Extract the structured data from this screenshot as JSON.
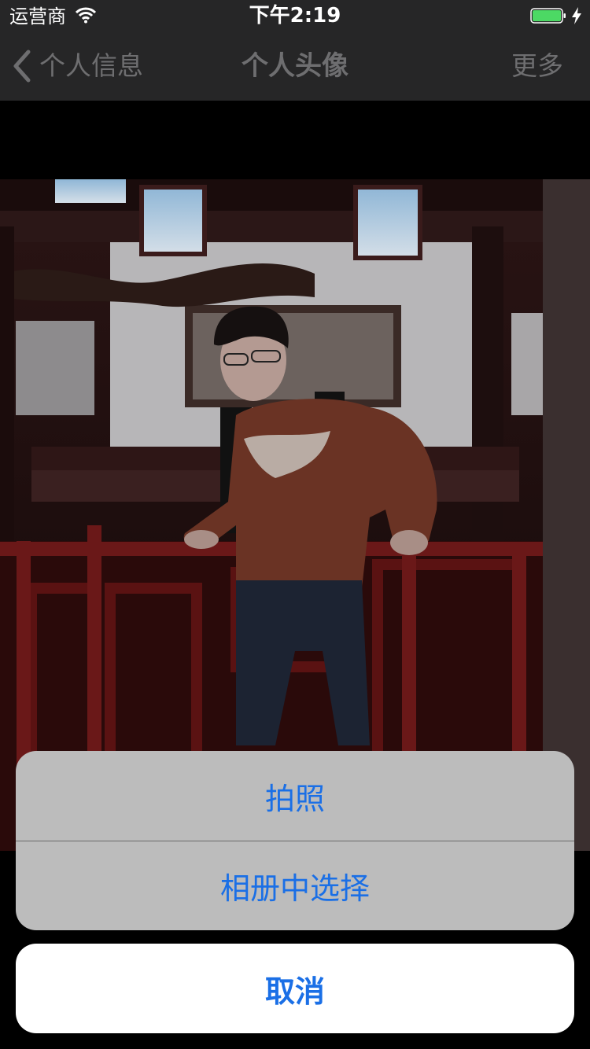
{
  "status_bar": {
    "carrier": "运营商",
    "time": "下午2:19",
    "battery_color": "#4cd964",
    "icons": [
      "wifi-icon",
      "battery-icon",
      "charging-bolt-icon"
    ]
  },
  "nav_bar": {
    "back_label": "个人信息",
    "title": "个人头像",
    "more_label": "更多",
    "back_icon": "chevron-left-icon"
  },
  "action_sheet": {
    "options": [
      {
        "label": "拍照"
      },
      {
        "label": "相册中选择"
      }
    ],
    "cancel_label": "取消",
    "accent_color": "#1a6fe6"
  }
}
